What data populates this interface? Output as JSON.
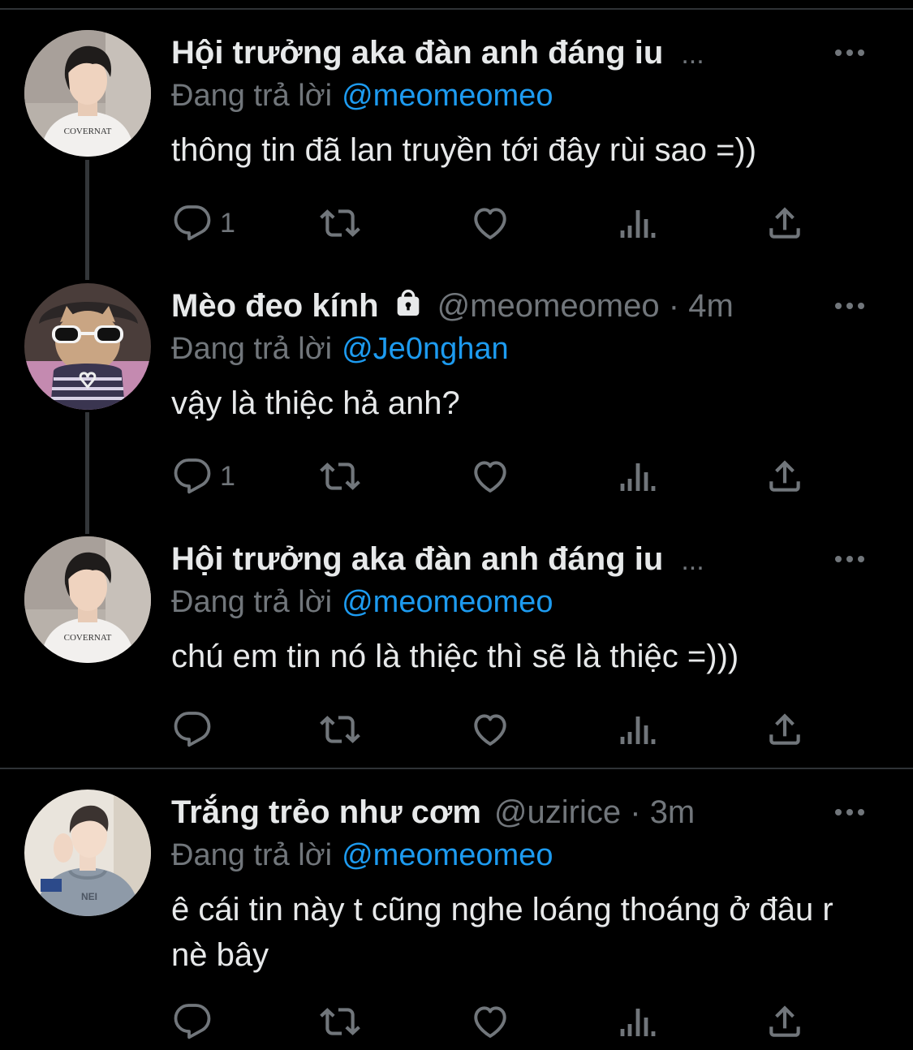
{
  "colors": {
    "background": "#000000",
    "text": "#e7e9ea",
    "muted": "#71767b",
    "link": "#1d9bf0",
    "divider": "#2f3336",
    "thread_line": "#333639"
  },
  "tweets": [
    {
      "name": "Hội trưởng aka đàn anh đáng iu",
      "name_truncated": "...",
      "handle": "",
      "time": "",
      "locked": false,
      "replying_label": "Đang trả lời",
      "reply_to": "@meomeomeo",
      "text": "thông tin đã lan truyền tới đây rùi sao =))",
      "reply_count": "1",
      "avatar_icon": "avatar-photo-white-tshirt"
    },
    {
      "name": "Mèo đeo kính",
      "name_truncated": "",
      "handle": "@meomeomeo",
      "time": "4m",
      "locked": true,
      "replying_label": "Đang trả lời",
      "reply_to": "@Je0nghan",
      "text": "vậy là thiệc hả anh?",
      "reply_count": "1",
      "avatar_icon": "avatar-photo-cat-sunglasses"
    },
    {
      "name": "Hội trưởng aka đàn anh đáng iu",
      "name_truncated": "...",
      "handle": "",
      "time": "",
      "locked": false,
      "replying_label": "Đang trả lời",
      "reply_to": "@meomeomeo",
      "text": "chú em tin nó là thiệc thì sẽ là thiệc =)))",
      "reply_count": "",
      "avatar_icon": "avatar-photo-white-tshirt"
    },
    {
      "name": "Trắng trẻo như cơm",
      "name_truncated": "",
      "handle": "@uzirice",
      "time": "3m",
      "locked": false,
      "replying_label": "Đang trả lời",
      "reply_to": "@meomeomeo",
      "text": "ê cái tin này t cũng nghe loáng thoáng ở đâu r nè bây",
      "reply_count": "",
      "avatar_icon": "avatar-photo-grey-hoodie"
    }
  ],
  "separator": "·",
  "icons": {
    "reply": "reply-icon",
    "retweet": "retweet-icon",
    "like": "heart-icon",
    "analytics": "analytics-icon",
    "share": "share-icon",
    "more": "more-icon",
    "lock": "lock-icon"
  }
}
